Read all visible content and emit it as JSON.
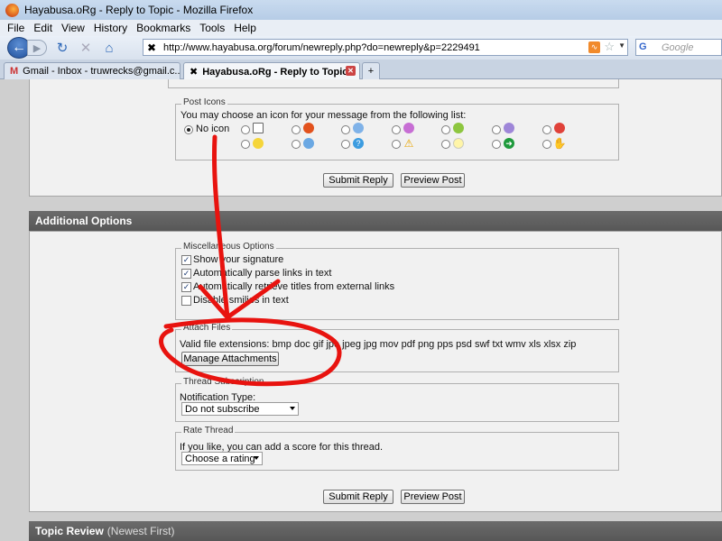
{
  "window": {
    "title": "Hayabusa.oRg - Reply to Topic - Mozilla Firefox"
  },
  "menu": [
    "File",
    "Edit",
    "View",
    "History",
    "Bookmarks",
    "Tools",
    "Help"
  ],
  "nav": {
    "url": "http://www.hayabusa.org/forum/newreply.php?do=newreply&p=2229491",
    "search_placeholder": "Google",
    "search_engine": "G"
  },
  "tabs": [
    {
      "label": "Gmail - Inbox - truwrecks@gmail.c..."
    },
    {
      "label": "Hayabusa.oRg - Reply to Topic"
    }
  ],
  "post_icons": {
    "legend": "Post Icons",
    "instruction": "You may choose an icon for your message from the following list:",
    "no_icon_label": "No icon",
    "icons_row1": [
      "post-icon-document",
      "post-icon-thumbs-down",
      "post-icon-wink",
      "post-icon-tongue",
      "post-icon-grin",
      "post-icon-frown",
      "post-icon-mad"
    ],
    "icons_row2": [
      "post-icon-smile",
      "post-icon-cool",
      "post-icon-question",
      "post-icon-warning",
      "post-icon-lightbulb",
      "post-icon-arrow",
      "post-icon-thumbs-up"
    ]
  },
  "buttons": {
    "submit": "Submit Reply",
    "preview": "Preview Post",
    "manage_attachments": "Manage Attachments"
  },
  "additional_options": {
    "title": "Additional Options"
  },
  "misc": {
    "legend": "Miscellaneous Options",
    "options": [
      {
        "label": "Show your signature",
        "checked": true
      },
      {
        "label": "Automatically parse links in text",
        "checked": true
      },
      {
        "label": "Automatically retrieve titles from external links",
        "checked": true
      },
      {
        "label": "Disable smilies in text",
        "checked": false
      }
    ]
  },
  "attach": {
    "legend": "Attach Files",
    "extensions": "Valid file extensions: bmp doc gif jpe jpeg jpg mov pdf png pps psd swf txt wmv xls xlsx zip"
  },
  "thread_sub": {
    "legend": "Thread Subscription",
    "label": "Notification Type:",
    "value": "Do not subscribe"
  },
  "rate": {
    "legend": "Rate Thread",
    "label": "If you like, you can add a score for this thread.",
    "value": "Choose a rating"
  },
  "topic_review": {
    "title": "Topic Review",
    "subtitle": "(Newest First)"
  },
  "colors": {
    "annotation": "#e8130f",
    "panel_header": "#5f5f5f"
  }
}
